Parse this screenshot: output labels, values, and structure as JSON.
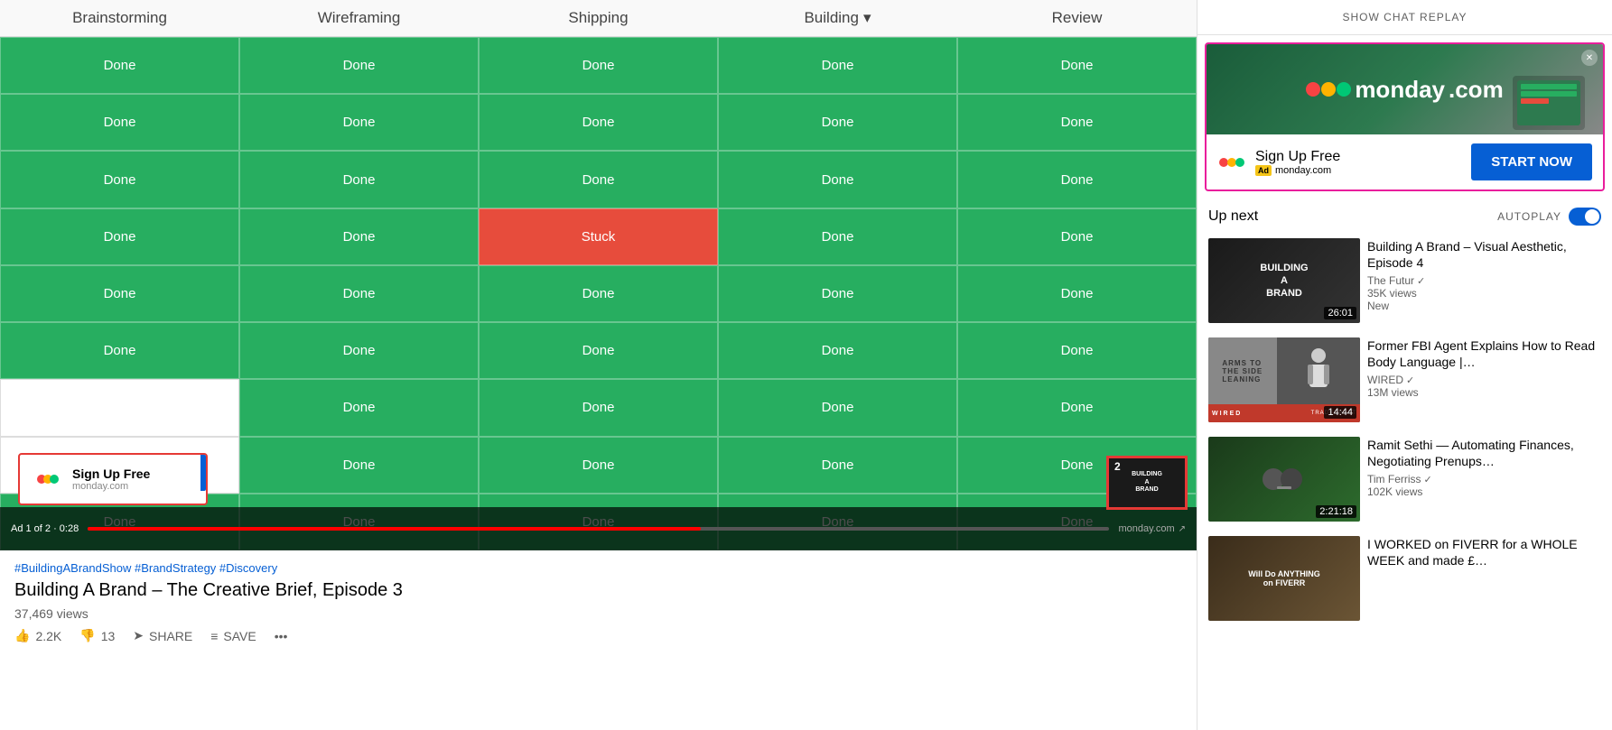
{
  "header": {
    "show_chat_replay": "SHOW CHAT REPLAY"
  },
  "table": {
    "columns": [
      "Brainstorming",
      "Wireframing",
      "Shipping",
      "Building",
      "Review"
    ],
    "rows": [
      [
        "Done",
        "Done",
        "Done",
        "Done",
        "Done"
      ],
      [
        "Done",
        "Done",
        "Done",
        "Done",
        "Done"
      ],
      [
        "Done",
        "Done",
        "Done",
        "Done",
        "Done"
      ],
      [
        "Done",
        "Done",
        "Stuck",
        "Done",
        "Done"
      ],
      [
        "Done",
        "Done",
        "Done",
        "Done",
        "Done"
      ],
      [
        "Done",
        "Done",
        "Done",
        "Done",
        "Done"
      ],
      [
        "",
        "Done",
        "Done",
        "Done",
        "Done"
      ],
      [
        "",
        "Done",
        "Done",
        "Done",
        "Done"
      ],
      [
        "Done",
        "Done",
        "Done",
        "Done",
        "Done"
      ]
    ]
  },
  "ad_overlay": {
    "title": "Sign Up Free",
    "domain": "monday.com"
  },
  "video_controls": {
    "ad_label": "Ad 1 of 2 · 0:28",
    "domain": "monday.com"
  },
  "below_video": {
    "hashtags": "#BuildingABrandShow #BrandStrategy #Discovery",
    "title": "Building A Brand – The Creative Brief, Episode 3",
    "views": "37,469 views",
    "likes": "2.2K",
    "dislikes": "13",
    "share": "SHARE",
    "save": "SAVE"
  },
  "sidebar": {
    "ad_banner": {
      "title": "Sign Up Free",
      "ad_label": "Ad",
      "domain": "monday.com",
      "cta": "START NOW",
      "monday_text": "monday.com"
    },
    "up_next": "Up next",
    "autoplay": "AUTOPLAY",
    "videos": [
      {
        "title": "Building A Brand – Visual Aesthetic, Episode 4",
        "channel": "The Futur",
        "views": "35K views",
        "extra": "New",
        "duration": "26:01",
        "thumb_type": "building"
      },
      {
        "title": "Former FBI Agent Explains How to Read Body Language |…",
        "channel": "WIRED",
        "views": "13M views",
        "extra": "",
        "duration": "14:44",
        "thumb_type": "wired"
      },
      {
        "title": "Ramit Sethi — Automating Finances, Negotiating Prenups…",
        "channel": "Tim Ferriss",
        "views": "102K views",
        "extra": "",
        "duration": "2:21:18",
        "thumb_type": "ramit"
      },
      {
        "title": "I WORKED on FIVERR for a WHOLE WEEK and made £…",
        "channel": "",
        "views": "",
        "extra": "",
        "duration": "",
        "thumb_type": "fiverr"
      }
    ]
  }
}
